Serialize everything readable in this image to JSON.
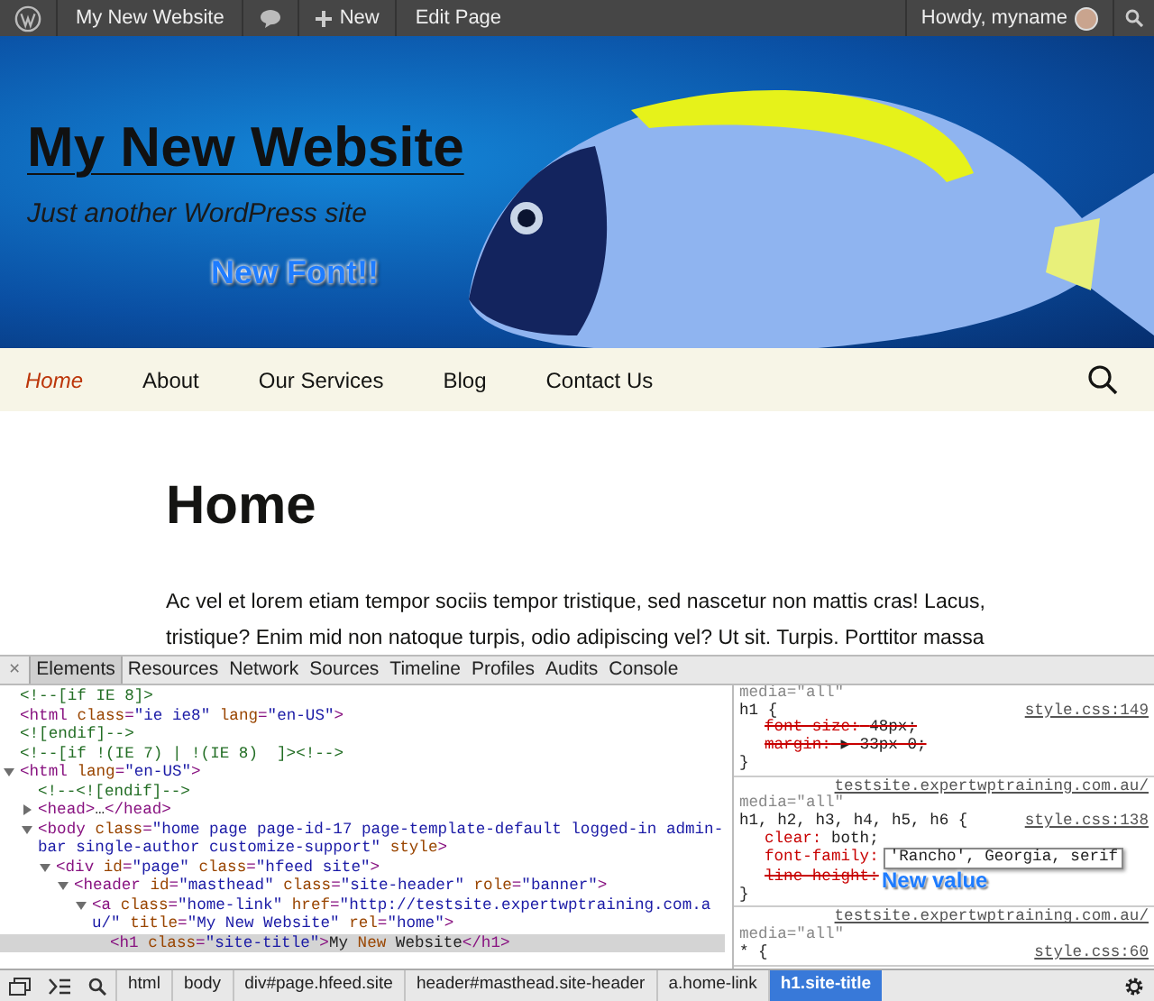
{
  "admin_bar": {
    "site": "My New Website",
    "new": "New",
    "edit": "Edit Page",
    "greeting": "Howdy, myname"
  },
  "header": {
    "title": "My New Website",
    "tagline": "Just another WordPress site",
    "annotation": "New Font!!"
  },
  "nav": {
    "items": [
      {
        "label": "Home",
        "selected": true
      },
      {
        "label": "About",
        "selected": false
      },
      {
        "label": "Our Services",
        "selected": false
      },
      {
        "label": "Blog",
        "selected": false
      },
      {
        "label": "Contact Us",
        "selected": false
      }
    ]
  },
  "page": {
    "heading": "Home",
    "paragraph": "Ac vel et lorem etiam tempor sociis tempor tristique, sed nascetur non mattis cras! Lacus, tristique? Enim mid non natoque turpis, odio adipiscing vel? Ut sit. Turpis. Porttitor massa"
  },
  "devtools": {
    "close": "×",
    "tabs": [
      {
        "label": "Elements",
        "selected": true
      },
      {
        "label": "Resources",
        "selected": false
      },
      {
        "label": "Network",
        "selected": false
      },
      {
        "label": "Sources",
        "selected": false
      },
      {
        "label": "Timeline",
        "selected": false
      },
      {
        "label": "Profiles",
        "selected": false
      },
      {
        "label": "Audits",
        "selected": false
      },
      {
        "label": "Console",
        "selected": false
      }
    ],
    "dom": [
      {
        "kind": "comment",
        "text": "<!--[if IE 8]>",
        "selected": false
      },
      {
        "kind": "element",
        "text": "<html class=\"ie ie8\" lang=\"en-US\">",
        "selected": false
      },
      {
        "kind": "comment",
        "text": "<![endif]-->",
        "selected": false
      },
      {
        "kind": "comment",
        "text": "<!--[if !(IE 7) | !(IE 8)  ]><!-->",
        "selected": false
      },
      {
        "kind": "element",
        "text": "<html lang=\"en-US\">",
        "selected": false,
        "expanded": true,
        "children": [
          {
            "kind": "comment",
            "text": "<!--<![endif]-->",
            "selected": false
          },
          {
            "kind": "element",
            "text": "<head>…</head>",
            "selected": false,
            "expanded": false
          },
          {
            "kind": "element",
            "text": "<body class=\"home page page-id-17 page-template-default logged-in admin-bar single-author customize-support\" style>",
            "selected": false,
            "expanded": true,
            "children": [
              {
                "kind": "element",
                "text": "<div id=\"page\" class=\"hfeed site\">",
                "selected": false,
                "expanded": true,
                "children": [
                  {
                    "kind": "element",
                    "text": "<header id=\"masthead\" class=\"site-header\" role=\"banner\">",
                    "selected": false,
                    "expanded": true,
                    "children": [
                      {
                        "kind": "element",
                        "text": "<a class=\"home-link\" href=\"http://testsite.expertwptraining.com.au/\" title=\"My New Website\" rel=\"home\">",
                        "selected": false,
                        "expanded": true,
                        "children": [
                          {
                            "kind": "element",
                            "text": "<h1 class=\"site-title\">My New Website</h1>",
                            "selected": true
                          }
                        ]
                      }
                    ]
                  }
                ]
              }
            ]
          }
        ]
      }
    ],
    "rules": [
      {
        "media": "media=\"all\"",
        "selector": "h1 {",
        "location": "style.css:149",
        "properties": [
          {
            "name": "font-size:",
            "value": "48px;",
            "overridden": true
          },
          {
            "name": "margin:",
            "value": "▶ 33px 0;",
            "overridden": true
          }
        ],
        "close": "}"
      },
      {
        "source": "testsite.expertwptraining.com.au/",
        "media": "media=\"all\"",
        "selector": "h1, h2, h3, h4, h5, h6 {",
        "location": "style.css:138",
        "properties": [
          {
            "name": "clear:",
            "value": "both;",
            "overridden": false
          },
          {
            "name": "font-family:",
            "value": "'Rancho', Georgia, serif",
            "overridden": false,
            "editing": true
          },
          {
            "name": "line-height:",
            "overridden": true
          }
        ],
        "close": "}",
        "annotation": "New value"
      },
      {
        "source": "testsite.expertwptraining.com.au/",
        "media": "media=\"all\"",
        "selector": "* {",
        "location": "style.css:60"
      }
    ],
    "breadcrumbs": [
      {
        "label": "html",
        "selected": false
      },
      {
        "label": "body",
        "selected": false
      },
      {
        "label": "div#page.hfeed.site",
        "selected": false
      },
      {
        "label": "header#masthead.site-header",
        "selected": false
      },
      {
        "label": "a.home-link",
        "selected": false
      },
      {
        "label": "h1.site-title",
        "selected": true
      }
    ]
  }
}
